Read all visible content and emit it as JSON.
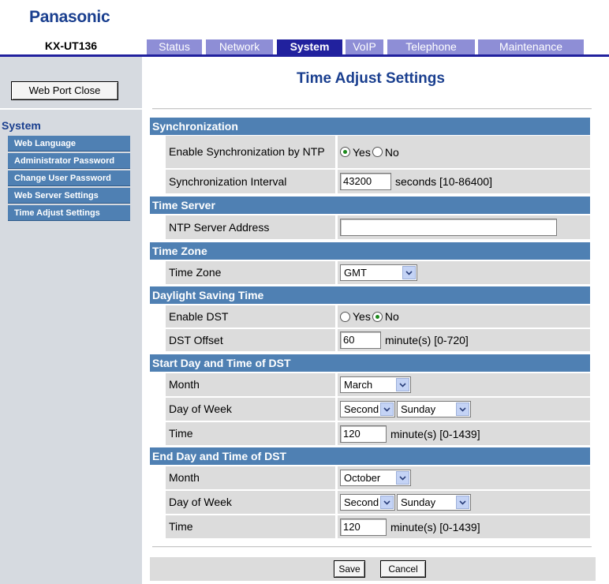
{
  "brand": "Panasonic",
  "model": "KX-UT136",
  "tabs": [
    {
      "label": "Status"
    },
    {
      "label": "Network"
    },
    {
      "label": "System"
    },
    {
      "label": "VoIP"
    },
    {
      "label": "Telephone"
    },
    {
      "label": "Maintenance"
    }
  ],
  "active_tab": "System",
  "sidebar": {
    "web_port_close": "Web Port Close",
    "section_title": "System",
    "items": [
      {
        "label": "Web Language"
      },
      {
        "label": "Administrator Password"
      },
      {
        "label": "Change User Password"
      },
      {
        "label": "Web Server Settings"
      },
      {
        "label": "Time Adjust Settings"
      }
    ],
    "selected_item": "Time Adjust Settings"
  },
  "page_title": "Time Adjust Settings",
  "sections": {
    "sync": {
      "title": "Synchronization",
      "enable_label": "Enable Synchronization by NTP",
      "enable_yes": "Yes",
      "enable_no": "No",
      "enable_value": "Yes",
      "interval_label": "Synchronization Interval",
      "interval_value": "43200",
      "interval_unit": "seconds [10-86400]"
    },
    "time_server": {
      "title": "Time Server",
      "ntp_label": "NTP Server Address",
      "ntp_value": ""
    },
    "time_zone": {
      "title": "Time Zone",
      "label": "Time Zone",
      "value": "GMT"
    },
    "dst": {
      "title": "Daylight Saving Time",
      "enable_label": "Enable DST",
      "enable_yes": "Yes",
      "enable_no": "No",
      "enable_value": "No",
      "offset_label": "DST Offset",
      "offset_value": "60",
      "offset_unit": "minute(s) [0-720]"
    },
    "dst_start": {
      "title": "Start Day and Time of DST",
      "month_label": "Month",
      "month_value": "March",
      "dow_label": "Day of Week",
      "week_value": "Second",
      "day_value": "Sunday",
      "time_label": "Time",
      "time_value": "120",
      "time_unit": "minute(s) [0-1439]"
    },
    "dst_end": {
      "title": "End Day and Time of DST",
      "month_label": "Month",
      "month_value": "October",
      "dow_label": "Day of Week",
      "week_value": "Second",
      "day_value": "Sunday",
      "time_label": "Time",
      "time_value": "120",
      "time_unit": "minute(s) [0-1439]"
    }
  },
  "buttons": {
    "save": "Save",
    "cancel": "Cancel"
  },
  "colors": {
    "brand_blue": "#1a3f8f",
    "nav_active": "#21219e",
    "nav_inactive": "#8e8ed6",
    "section_header": "#4f80b3",
    "row_bg": "#dcdcdc",
    "radio_on": "#1d8a1d"
  }
}
